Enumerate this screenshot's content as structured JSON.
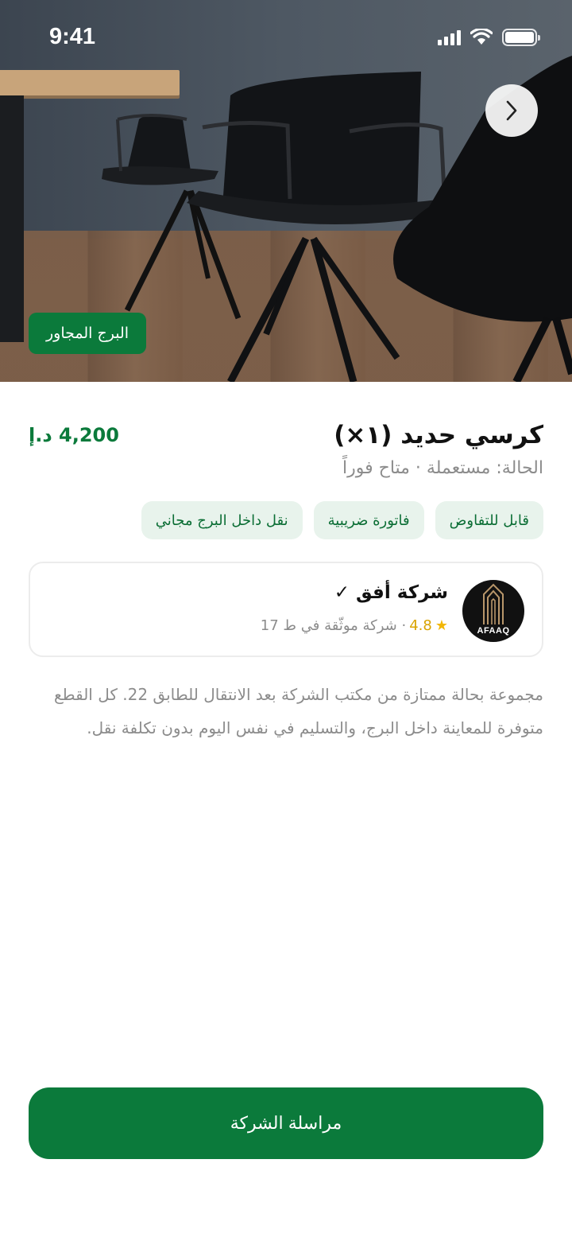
{
  "status_bar": {
    "time": "9:41"
  },
  "hero": {
    "location_badge": "البرج المجاور",
    "next_icon": "chevron-right-icon"
  },
  "listing": {
    "title": "كرسي حديد (١×)",
    "price": "4,200 د.إ",
    "condition": "الحالة: مستعملة · متاح فوراً",
    "tags": [
      "قابل للتفاوض",
      "فاتورة ضريبية",
      "نقل داخل البرج مجاني"
    ],
    "description": "مجموعة بحالة ممتازة من مكتب الشركة بعد الانتقال للطابق 22. كل القطع متوفرة للمعاينة داخل البرج، والتسليم في نفس اليوم بدون تكلفة نقل."
  },
  "seller": {
    "name": "شركة أفق ✓",
    "star": "★",
    "rating": "4.8",
    "meta": "· شركة موثّقة في ط 17",
    "avatar_text": "AFAAQ"
  },
  "cta": {
    "label": "مراسلة الشركة"
  },
  "colors": {
    "primary": "#0b7a3b",
    "chip_bg": "#e8f3ec",
    "muted": "#8c8c8c",
    "star": "#f2b705"
  }
}
